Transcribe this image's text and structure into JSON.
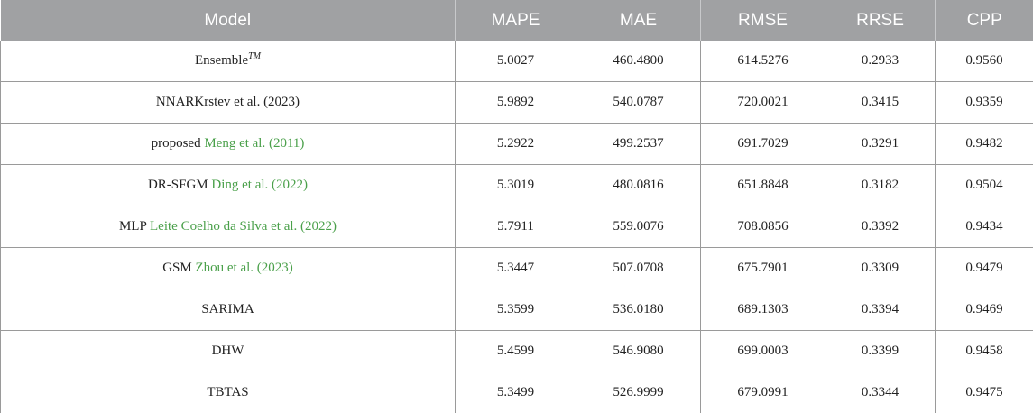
{
  "headers": [
    "Model",
    "MAPE",
    "MAE",
    "RMSE",
    "RRSE",
    "CPP"
  ],
  "rows": [
    {
      "model": "Ensemble",
      "model_sup": "TM",
      "ref": "",
      "values": [
        "5.0027",
        "460.4800",
        "614.5276",
        "0.2933",
        "0.9560"
      ]
    },
    {
      "model": "NNARKrstev et al. (2023)",
      "ref": "",
      "values": [
        "5.9892",
        "540.0787",
        "720.0021",
        "0.3415",
        "0.9359"
      ]
    },
    {
      "model": "proposed ",
      "ref": "Meng et al. (2011)",
      "values": [
        "5.2922",
        "499.2537",
        "691.7029",
        "0.3291",
        "0.9482"
      ]
    },
    {
      "model": "DR-SFGM ",
      "ref": "Ding et al. (2022)",
      "values": [
        "5.3019",
        "480.0816",
        "651.8848",
        "0.3182",
        "0.9504"
      ]
    },
    {
      "model": "MLP ",
      "ref": "Leite Coelho da Silva et al. (2022)",
      "values": [
        "5.7911",
        "559.0076",
        "708.0856",
        "0.3392",
        "0.9434"
      ]
    },
    {
      "model": "GSM ",
      "ref": "Zhou et al. (2023)",
      "values": [
        "5.3447",
        "507.0708",
        "675.7901",
        "0.3309",
        "0.9479"
      ]
    },
    {
      "model": "SARIMA",
      "ref": "",
      "values": [
        "5.3599",
        "536.0180",
        "689.1303",
        "0.3394",
        "0.9469"
      ]
    },
    {
      "model": "DHW",
      "ref": "",
      "values": [
        "5.4599",
        "546.9080",
        "699.0003",
        "0.3399",
        "0.9458"
      ]
    },
    {
      "model": "TBTAS",
      "ref": "",
      "values": [
        "5.3499",
        "526.9999",
        "679.0991",
        "0.3344",
        "0.9475"
      ]
    }
  ],
  "colors": {
    "header_bg": "#a0a1a3",
    "header_text": "#ffffff",
    "reference_link": "#4aa04a"
  }
}
